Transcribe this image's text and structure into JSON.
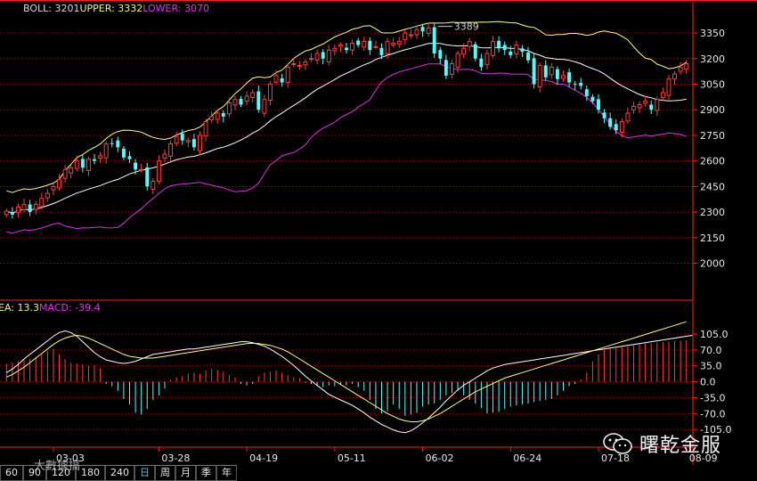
{
  "boll_legend": {
    "name": "BOLL",
    "mid_value": "3201",
    "upper_label": "UPPER",
    "upper_value": "3332",
    "lower_label": "LOWER",
    "lower_value": "3070"
  },
  "macd_legend": {
    "dea_label": "EA",
    "dea_value": "13.3",
    "macd_label": "MACD",
    "macd_value": "-39.4"
  },
  "period_buttons": [
    {
      "label": "60",
      "active": false
    },
    {
      "label": "90",
      "active": false
    },
    {
      "label": "120",
      "active": false
    },
    {
      "label": "180",
      "active": false
    },
    {
      "label": "240",
      "active": false
    },
    {
      "label": "日",
      "active": true
    },
    {
      "label": "周",
      "active": false
    },
    {
      "label": "月",
      "active": false
    },
    {
      "label": "季",
      "active": false
    },
    {
      "label": "年",
      "active": false
    }
  ],
  "watermark": {
    "text": "曙乾金服",
    "small_text": "大數據搞"
  },
  "colors": {
    "up": "#ff3c3c",
    "down": "#54fcfc",
    "boll_mid": "#ffffff",
    "boll_upper": "#ffff80",
    "boll_lower": "#e030e0",
    "grid": "#b00000",
    "axis": "#ff2020"
  },
  "chart_data": [
    {
      "type": "candlestick",
      "title": "BOLL",
      "y_ticks": [
        2000,
        2150,
        2300,
        2450,
        2600,
        2750,
        2900,
        3050,
        3200,
        3350
      ],
      "y_tick_labels": [
        "2000",
        "2150",
        "2300",
        "2450",
        "2600",
        "2750",
        "2900",
        "3050",
        "3200",
        "3350"
      ],
      "ylim": [
        1820,
        3460
      ],
      "date_labels": [
        "03-03",
        "03-28",
        "04-19",
        "05-11",
        "06-02",
        "06-24",
        "07-18",
        "08-09"
      ],
      "date_label_index": [
        8,
        26,
        41,
        56,
        71,
        86,
        101,
        116
      ],
      "peak_annotation": {
        "label": "3389",
        "value": 3389,
        "index": 73
      },
      "close": [
        2305,
        2285,
        2330,
        2345,
        2300,
        2345,
        2380,
        2410,
        2450,
        2490,
        2550,
        2560,
        2600,
        2560,
        2610,
        2600,
        2630,
        2700,
        2700,
        2680,
        2620,
        2610,
        2550,
        2550,
        2450,
        2480,
        2600,
        2640,
        2700,
        2740,
        2720,
        2720,
        2680,
        2750,
        2830,
        2860,
        2880,
        2860,
        2940,
        2960,
        2930,
        2980,
        3000,
        2900,
        2960,
        3050,
        3100,
        3060,
        3150,
        3170,
        3160,
        3180,
        3200,
        3230,
        3200,
        3250,
        3260,
        3280,
        3250,
        3290,
        3280,
        3300,
        3250,
        3270,
        3220,
        3300,
        3290,
        3300,
        3350,
        3340,
        3370,
        3360,
        3380,
        3230,
        3200,
        3100,
        3170,
        3230,
        3260,
        3300,
        3200,
        3150,
        3230,
        3300,
        3260,
        3250,
        3220,
        3280,
        3240,
        3190,
        3050,
        3160,
        3090,
        3150,
        3080,
        3100,
        3060,
        3050,
        3040,
        2980,
        2950,
        2900,
        2850,
        2800,
        2780,
        2830,
        2880,
        2920,
        2930,
        2950,
        2900,
        2960,
        3000,
        3080,
        3110,
        3150,
        3170
      ]
    },
    {
      "type": "macd",
      "y_ticks": [
        105.0,
        70.0,
        35.0,
        0.0,
        -35.0,
        -70.0,
        -105.0
      ],
      "y_tick_labels": [
        "105.0",
        "70.0",
        "35.0",
        "0.0",
        "-35.0",
        "-70.0",
        "-105.0"
      ],
      "ylim": [
        -140,
        150
      ],
      "macd_bars": [
        40,
        42,
        45,
        48,
        50,
        55,
        60,
        68,
        72,
        60,
        50,
        42,
        40,
        38,
        35,
        36,
        30,
        -5,
        -10,
        -20,
        -38,
        -50,
        -68,
        -72,
        -60,
        -40,
        -30,
        -15,
        5,
        10,
        12,
        18,
        20,
        18,
        25,
        28,
        26,
        22,
        15,
        10,
        -5,
        -8,
        -5,
        12,
        20,
        22,
        25,
        20,
        15,
        10,
        8,
        -3,
        -5,
        -10,
        -12,
        -8,
        -10,
        -6,
        -8,
        -5,
        -12,
        -20,
        -40,
        -60,
        -70,
        -65,
        -50,
        -60,
        -75,
        -72,
        -68,
        -55,
        -50,
        -48,
        -40,
        -30,
        -25,
        -20,
        -30,
        -40,
        -48,
        -58,
        -70,
        -68,
        -66,
        -60,
        -55,
        -52,
        -50,
        -48,
        -45,
        -42,
        -40,
        -38,
        -30,
        -20,
        -10,
        -5,
        5,
        20,
        45,
        60,
        70,
        72,
        74,
        76,
        78,
        80,
        82,
        84,
        85,
        86,
        87,
        88,
        89,
        90,
        91
      ],
      "dif": [
        20,
        28,
        38,
        50,
        60,
        70,
        80,
        90,
        100,
        108,
        112,
        108,
        100,
        88,
        76,
        64,
        55,
        48,
        45,
        42,
        40,
        42,
        45,
        50,
        55,
        60,
        62,
        64,
        66,
        68,
        70,
        72,
        72,
        74,
        76,
        78,
        80,
        82,
        84,
        86,
        88,
        88,
        86,
        82,
        78,
        72,
        64,
        56,
        46,
        36,
        24,
        12,
        2,
        -8,
        -18,
        -28,
        -34,
        -40,
        -46,
        -52,
        -60,
        -68,
        -78,
        -86,
        -94,
        -100,
        -106,
        -110,
        -112,
        -108,
        -100,
        -90,
        -80,
        -68,
        -56,
        -42,
        -30,
        -18,
        -8,
        0,
        8,
        16,
        24,
        30,
        34,
        38,
        40,
        42,
        44,
        46,
        48,
        50,
        52,
        54,
        56,
        58,
        60,
        62,
        64,
        66,
        68,
        70,
        72,
        74,
        76,
        78,
        80,
        82,
        84,
        86,
        88,
        90,
        92,
        94,
        96,
        98,
        100,
        102
      ],
      "dea": [
        10,
        16,
        24,
        32,
        42,
        52,
        62,
        72,
        82,
        90,
        96,
        100,
        102,
        100,
        96,
        90,
        84,
        78,
        72,
        66,
        60,
        56,
        54,
        52,
        52,
        52,
        54,
        56,
        58,
        60,
        62,
        64,
        66,
        68,
        70,
        72,
        74,
        76,
        78,
        80,
        82,
        84,
        85,
        84,
        82,
        80,
        76,
        72,
        66,
        58,
        50,
        42,
        34,
        26,
        18,
        10,
        2,
        -6,
        -14,
        -22,
        -30,
        -38,
        -46,
        -54,
        -62,
        -70,
        -76,
        -82,
        -86,
        -88,
        -88,
        -86,
        -82,
        -76,
        -70,
        -62,
        -54,
        -46,
        -38,
        -30,
        -22,
        -16,
        -10,
        -4,
        2,
        8,
        12,
        16,
        20,
        24,
        28,
        32,
        36,
        40,
        44,
        48,
        52,
        56,
        60,
        64,
        68,
        72,
        76,
        80,
        84,
        88,
        92,
        96,
        100,
        104,
        108,
        112,
        116,
        120,
        124,
        128,
        132
      ],
      "legend": [
        "EA",
        "MACD"
      ]
    }
  ]
}
